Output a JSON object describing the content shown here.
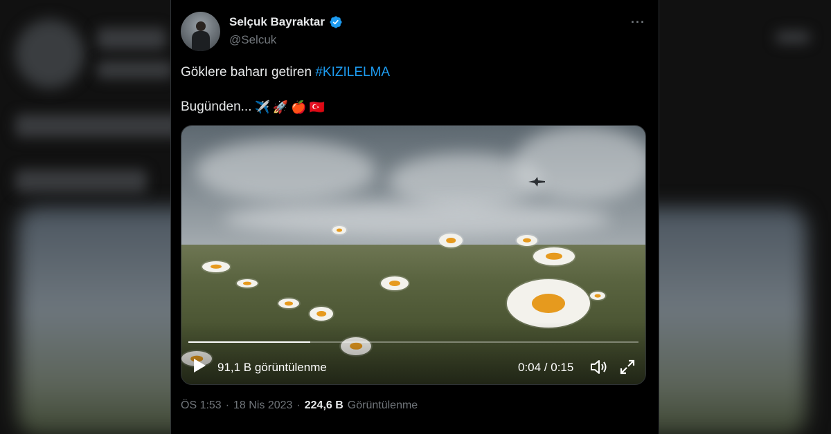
{
  "author": {
    "name": "Selçuk Bayraktar",
    "handle": "@Selcuk"
  },
  "tweet": {
    "text_prefix": "Göklere baharı getiren ",
    "hashtag": "#KIZILELMA",
    "line2_text": "Bugünden...",
    "emojis": [
      "✈️",
      "🚀",
      "🍎",
      "🇹🇷"
    ]
  },
  "video": {
    "views_label": "91,1 B görüntülenme",
    "time_label": "0:04 / 0:15",
    "progress_fraction": 0.27
  },
  "meta": {
    "time": "ÖS 1:53",
    "separator": "·",
    "date": "18 Nis 2023",
    "views_count": "224,6 B",
    "views_word": "Görüntülenme"
  },
  "colors": {
    "accent": "#1d9bf0",
    "muted": "#71767b",
    "text": "#e7e9ea",
    "background": "#000000"
  },
  "icons": [
    "verified-badge-icon",
    "more-icon",
    "play-icon",
    "volume-icon",
    "fullscreen-icon"
  ]
}
